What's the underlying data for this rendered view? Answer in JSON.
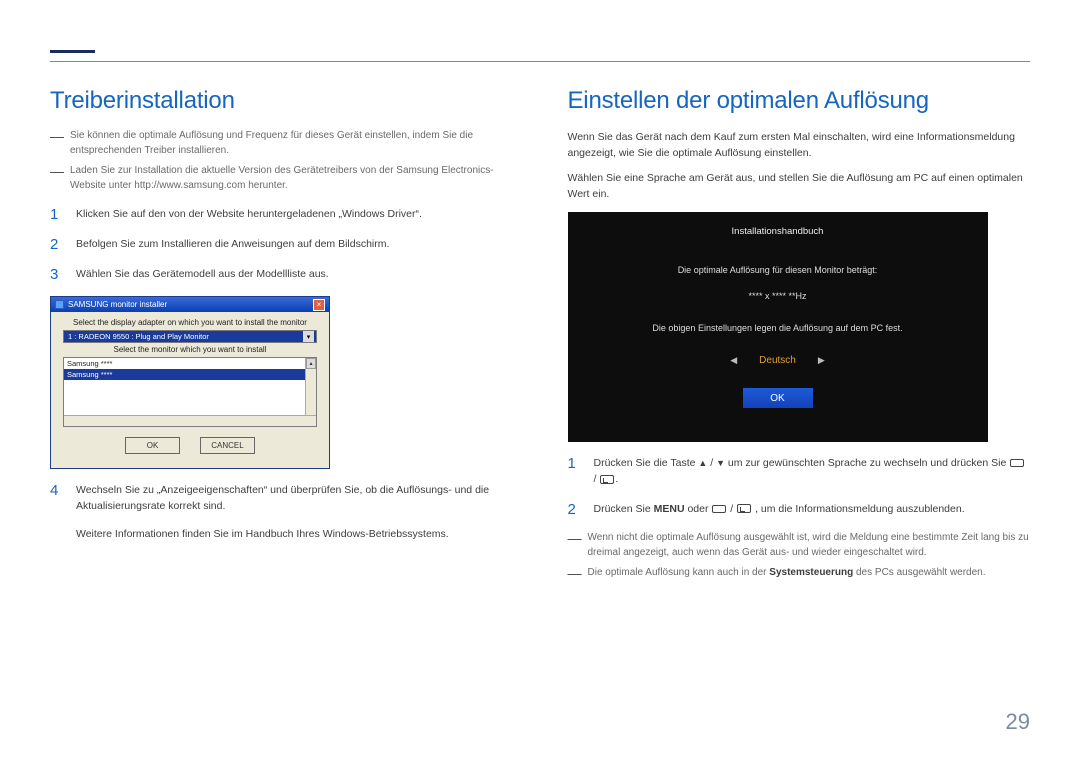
{
  "page_number": "29",
  "left": {
    "title": "Treiberinstallation",
    "notes": [
      "Sie können die optimale Auflösung und Frequenz für dieses Gerät einstellen, indem Sie die entsprechenden Treiber installieren.",
      "Laden Sie zur Installation die aktuelle Version des Gerätetreibers von der Samsung Electronics-Website unter http://www.samsung.com herunter."
    ],
    "steps": {
      "s1": "Klicken Sie auf den von der Website heruntergeladenen „Windows Driver“.",
      "s2": "Befolgen Sie zum Installieren die Anweisungen auf dem Bildschirm.",
      "s3": "Wählen Sie das Gerätemodell aus der Modellliste aus.",
      "s4": "Wechseln Sie zu „Anzeigeeigenschaften“ und überprüfen Sie, ob die Auflösungs- und die Aktualisierungsrate korrekt sind.",
      "s4_extra": "Weitere Informationen finden Sie im Handbuch Ihres Windows-Betriebssystems."
    },
    "installer": {
      "title": "SAMSUNG monitor installer",
      "label1": "Select the display adapter on which you want to install the monitor",
      "combo": "1 : RADEON 9550 : Plug and Play Monitor",
      "label2": "Select the monitor which you want to install",
      "list": [
        "Samsung ****",
        "Samsung ****"
      ],
      "ok": "OK",
      "cancel": "CANCEL"
    }
  },
  "right": {
    "title": "Einstellen der optimalen Auflösung",
    "intro1": "Wenn Sie das Gerät nach dem Kauf zum ersten Mal einschalten, wird eine Informationsmeldung angezeigt, wie Sie die optimale Auflösung einstellen.",
    "intro2": "Wählen Sie eine Sprache am Gerät aus, und stellen Sie die Auflösung am PC auf einen optimalen Wert ein.",
    "osd": {
      "title": "Installationshandbuch",
      "line1": "Die optimale Auflösung für diesen Monitor beträgt:",
      "spec": "**** x **** **Hz",
      "line2": "Die obigen Einstellungen legen die Auflösung auf dem PC fest.",
      "lang": "Deutsch",
      "ok": "OK"
    },
    "steps": {
      "s1_a": "Drücken Sie die Taste ",
      "s1_b": " um zur gewünschten Sprache zu wechseln und drücken Sie ",
      "s2_a": "Drücken Sie ",
      "s2_menu": "MENU",
      "s2_b": " oder ",
      "s2_c": ", um die Informationsmeldung auszublenden."
    },
    "end_notes": {
      "n1": "Wenn nicht die optimale Auflösung ausgewählt ist, wird die Meldung eine bestimmte Zeit lang bis zu dreimal angezeigt, auch wenn das Gerät aus- und wieder eingeschaltet wird.",
      "n2_a": "Die optimale Auflösung kann auch in der ",
      "n2_bold": "Systemsteuerung",
      "n2_b": " des PCs ausgewählt werden."
    }
  }
}
